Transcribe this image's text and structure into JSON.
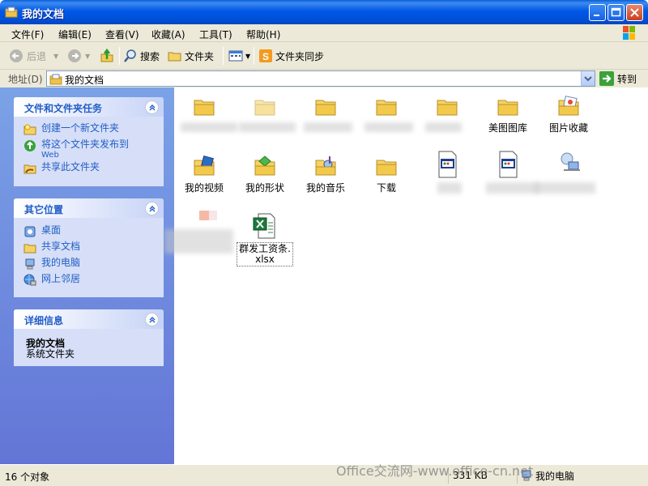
{
  "window": {
    "title": "我的文档"
  },
  "menu": [
    "文件(F)",
    "编辑(E)",
    "查看(V)",
    "收藏(A)",
    "工具(T)",
    "帮助(H)"
  ],
  "toolbar": {
    "back": "后退",
    "search": "搜索",
    "folders": "文件夹",
    "sync": "文件夹同步"
  },
  "address": {
    "label": "地址(D)",
    "value": "我的文档",
    "go": "转到"
  },
  "tasks_panel": {
    "title": "文件和文件夹任务",
    "items": [
      {
        "label": "创建一个新文件夹",
        "icon": "new-folder-icon"
      },
      {
        "label": "将这个文件夹发布到",
        "sub": "Web",
        "icon": "publish-web-icon"
      },
      {
        "label": "共享此文件夹",
        "icon": "share-folder-icon"
      }
    ]
  },
  "places_panel": {
    "title": "其它位置",
    "items": [
      {
        "label": "桌面",
        "icon": "desktop-icon"
      },
      {
        "label": "共享文档",
        "icon": "shared-docs-icon"
      },
      {
        "label": "我的电脑",
        "icon": "my-computer-icon"
      },
      {
        "label": "网上邻居",
        "icon": "network-icon"
      }
    ]
  },
  "details_panel": {
    "title": "详细信息",
    "name": "我的文档",
    "type": "系统文件夹"
  },
  "files": [
    {
      "name": "美图图库",
      "type": "folder"
    },
    {
      "name": "图片收藏",
      "type": "folder-pictures"
    },
    {
      "name": "我的视频",
      "type": "folder-video"
    },
    {
      "name": "我的形状",
      "type": "folder-shapes"
    },
    {
      "name": "我的音乐",
      "type": "folder-music"
    },
    {
      "name": "下载",
      "type": "folder"
    },
    {
      "name": "群发工资条.xlsx",
      "type": "excel"
    }
  ],
  "status": {
    "count": "16 个对象",
    "size": "331 KB",
    "location": "我的电脑"
  },
  "watermark": "Office交流网-www.office-cn.net",
  "colors": {
    "titlebar": "#0058E6",
    "taskpane": "#6375D6",
    "link": "#215DC6",
    "chrome": "#ECE9D8"
  }
}
